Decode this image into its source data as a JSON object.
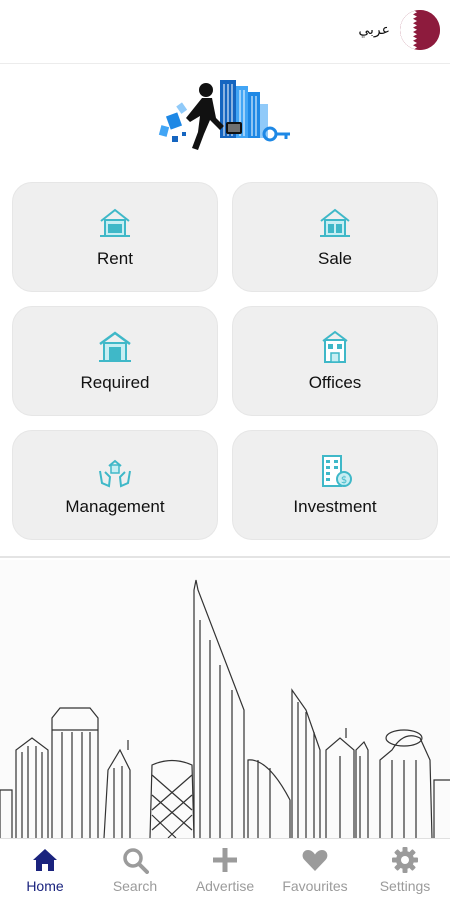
{
  "header": {
    "language_label": "عربي",
    "flag_icon": "qatar-flag-icon",
    "colors": {
      "flag_maroon": "#8d1b3d",
      "flag_white": "#ffffff"
    }
  },
  "menu": {
    "tiles": [
      {
        "label": "Rent",
        "icon": "house-key-icon"
      },
      {
        "label": "Sale",
        "icon": "house-tag-icon"
      },
      {
        "label": "Required",
        "icon": "house-icon"
      },
      {
        "label": "Offices",
        "icon": "office-building-icon"
      },
      {
        "label": "Management",
        "icon": "hands-house-icon"
      },
      {
        "label": "Investment",
        "icon": "building-coin-icon"
      }
    ],
    "colors": {
      "icon_teal": "#3fb8c8",
      "tile_bg": "#efefef"
    }
  },
  "bottom_nav": {
    "items": [
      {
        "label": "Home",
        "icon": "home-icon",
        "active": true
      },
      {
        "label": "Search",
        "icon": "search-icon",
        "active": false
      },
      {
        "label": "Advertise",
        "icon": "plus-icon",
        "active": false
      },
      {
        "label": "Favourites",
        "icon": "heart-icon",
        "active": false
      },
      {
        "label": "Settings",
        "icon": "gear-icon",
        "active": false
      }
    ],
    "colors": {
      "active": "#1a237e",
      "inactive": "#9b9b9b"
    }
  }
}
